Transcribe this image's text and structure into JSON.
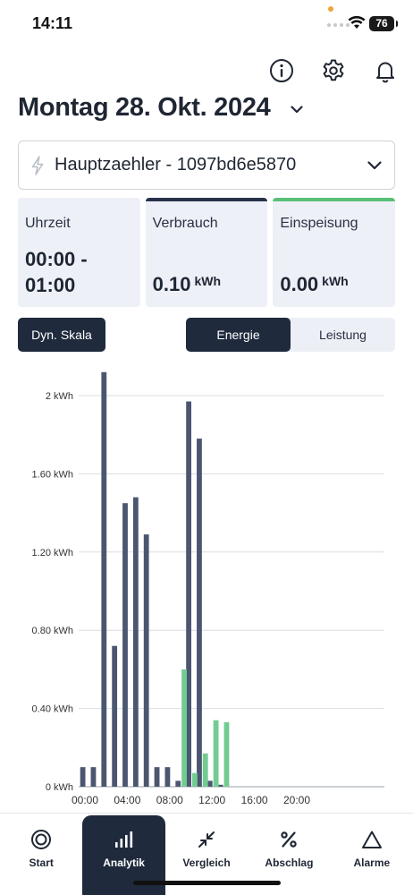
{
  "status_bar": {
    "time": "14:11",
    "battery": "76"
  },
  "header": {
    "date_title": "Montag 28. Okt. 2024",
    "icons": [
      "info-icon",
      "gear-icon",
      "bell-icon"
    ]
  },
  "meter": {
    "label": "Hauptzaehler - 1097bd6e5870",
    "icon": "lightning-icon"
  },
  "cards": [
    {
      "label": "Uhrzeit",
      "value_line1": "00:00 -",
      "value_line2": "01:00",
      "accent": ""
    },
    {
      "label": "Verbrauch",
      "value": "0.10",
      "unit": "kWh",
      "accent": "#27324a"
    },
    {
      "label": "Einspeisung",
      "value": "0.00",
      "unit": "kWh",
      "accent": "#59c078"
    }
  ],
  "controls": {
    "dyn_scale": "Dyn. Skala",
    "toggle_options": [
      "Energie",
      "Leistung"
    ],
    "toggle_active": "Energie"
  },
  "colors": {
    "consumption": "#4b5670",
    "feed_in": "#72cc92",
    "dark": "#1f2a3d"
  },
  "chart_data": {
    "type": "bar",
    "x_tick_labels": [
      "00:00",
      "04:00",
      "08:00",
      "12:00",
      "16:00",
      "20:00"
    ],
    "y_tick_labels": [
      "0 kWh",
      "0.40 kWh",
      "0.80 kWh",
      "1.20 kWh",
      "1.60 kWh",
      "2 kWh"
    ],
    "ylim": [
      0,
      2.0
    ],
    "categories": [
      "00",
      "01",
      "02",
      "03",
      "04",
      "05",
      "06",
      "07",
      "08",
      "09",
      "10",
      "11",
      "12",
      "13",
      "14",
      "15",
      "16",
      "17",
      "18",
      "19",
      "20",
      "21",
      "22",
      "23"
    ],
    "series": [
      {
        "values": [
          0.1,
          0.1,
          2.12,
          0.72,
          1.45,
          1.48,
          1.29,
          0.1,
          0.1,
          0.03,
          1.97,
          1.78,
          0.03,
          0.01,
          0,
          0,
          0,
          0,
          0,
          0,
          0,
          0,
          0,
          0
        ]
      },
      {
        "values": [
          0,
          0,
          0,
          0,
          0,
          0,
          0,
          0,
          0,
          0.6,
          0.07,
          0.17,
          0.34,
          0.33,
          0,
          0,
          0,
          0,
          0,
          0,
          0,
          0,
          0,
          0
        ]
      }
    ],
    "grid": true
  },
  "tabs": [
    {
      "label": "Start",
      "icon": "target-icon",
      "active": false
    },
    {
      "label": "Analytik",
      "icon": "bar-chart-icon",
      "active": true
    },
    {
      "label": "Vergleich",
      "icon": "compare-arrows-icon",
      "active": false
    },
    {
      "label": "Abschlag",
      "icon": "percent-icon",
      "active": false
    },
    {
      "label": "Alarme",
      "icon": "triangle-icon",
      "active": false
    }
  ]
}
